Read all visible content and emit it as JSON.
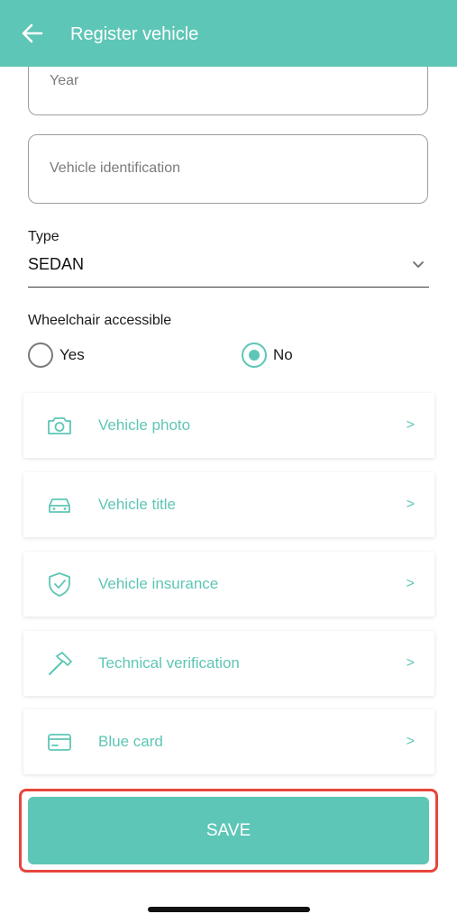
{
  "header": {
    "title": "Register vehicle",
    "back_icon": "arrow-left-icon",
    "background": "#5ec6b6"
  },
  "form": {
    "year_placeholder": "Year",
    "vin_placeholder": "Vehicle identification",
    "type_label": "Type",
    "type_value": "SEDAN",
    "wheelchair_label": "Wheelchair accessible",
    "wheelchair_options": [
      {
        "label": "Yes",
        "selected": false
      },
      {
        "label": "No",
        "selected": true
      }
    ]
  },
  "documents": [
    {
      "label": "Vehicle photo",
      "icon": "camera-icon",
      "arrow": ">"
    },
    {
      "label": "Vehicle title",
      "icon": "car-icon",
      "arrow": ">"
    },
    {
      "label": "Vehicle insurance",
      "icon": "shield-check-icon",
      "arrow": ">"
    },
    {
      "label": "Technical verification",
      "icon": "hammer-icon",
      "arrow": ">"
    },
    {
      "label": "Blue card",
      "icon": "credit-card-icon",
      "arrow": ">"
    }
  ],
  "save_label": "SAVE",
  "colors": {
    "accent": "#5ec6b6",
    "highlight": "#e8453c"
  }
}
